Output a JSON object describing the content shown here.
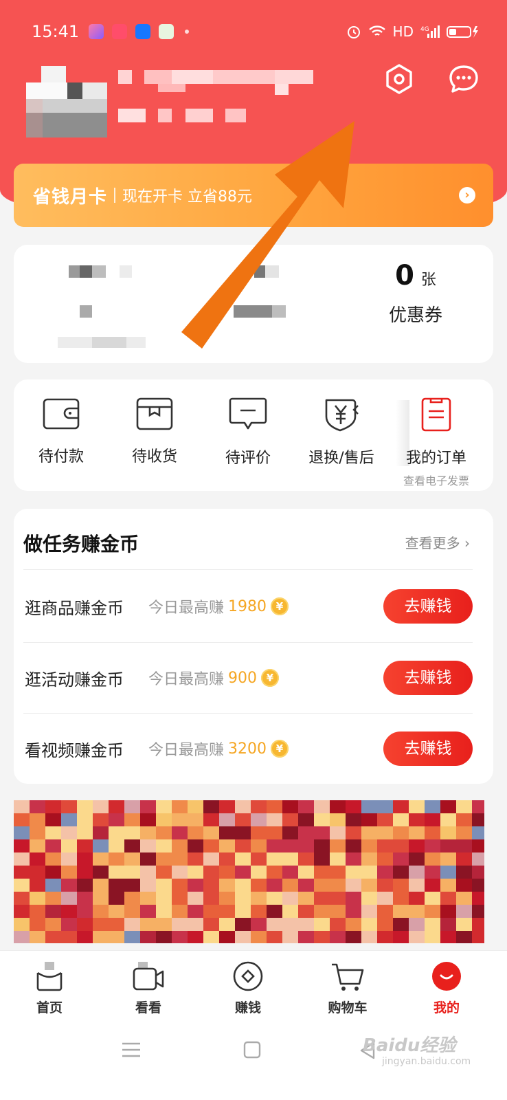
{
  "colors": {
    "header": "#f65352",
    "accent": "#e8201c",
    "coin": "#f7b731",
    "banner_gradient": "orange"
  },
  "status_bar": {
    "time": "15:41",
    "network": "HD",
    "signal_label": "4G"
  },
  "header": {
    "settings_icon": "settings-hex-icon",
    "message_icon": "chat-bubble-icon"
  },
  "banner": {
    "title": "省钱月卡",
    "subtitle": "现在开卡 立省88元",
    "go_icon": "chevron-right-circle-icon"
  },
  "wallet": {
    "coupon_count": "0",
    "coupon_unit": "张",
    "coupon_label": "优惠券"
  },
  "orders": {
    "items": [
      {
        "label": "待付款",
        "icon": "wallet-icon"
      },
      {
        "label": "待收货",
        "icon": "package-icon"
      },
      {
        "label": "待评价",
        "icon": "comment-icon"
      },
      {
        "label": "退换/售后",
        "icon": "refund-icon"
      },
      {
        "label": "我的订单",
        "icon": "order-list-icon",
        "sub": "查看电子发票"
      }
    ]
  },
  "tasks": {
    "title": "做任务赚金币",
    "more": "查看更多 ›",
    "rows": [
      {
        "name": "逛商品赚金币",
        "desc": "今日最高赚",
        "value": "1980",
        "button": "去赚钱"
      },
      {
        "name": "逛活动赚金币",
        "desc": "今日最高赚",
        "value": "900",
        "button": "去赚钱"
      },
      {
        "name": "看视频赚金币",
        "desc": "今日最高赚",
        "value": "3200",
        "button": "去赚钱"
      }
    ]
  },
  "tabbar": {
    "items": [
      {
        "label": "首页",
        "icon": "home-icon"
      },
      {
        "label": "看看",
        "icon": "video-icon"
      },
      {
        "label": "赚钱",
        "icon": "diamond-coin-icon"
      },
      {
        "label": "购物车",
        "icon": "cart-icon"
      },
      {
        "label": "我的",
        "icon": "profile-face-icon",
        "active": true
      }
    ]
  },
  "watermark": {
    "brand": "Baidu经验",
    "url": "jingyan.baidu.com"
  }
}
